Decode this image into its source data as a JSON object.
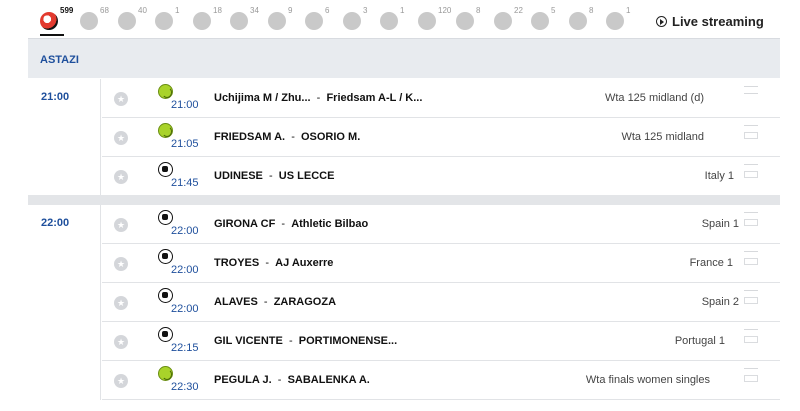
{
  "sportbar": {
    "items": [
      {
        "icon": "soccer-ball-icon",
        "count": "599",
        "active": true
      },
      {
        "icon": "soccer-ball-icon",
        "count": "68"
      },
      {
        "icon": "basketball-icon",
        "count": "40"
      },
      {
        "icon": "baseball-icon",
        "count": "1"
      },
      {
        "icon": "hockey-puck-icon",
        "count": "18"
      },
      {
        "icon": "tennis-ball-icon",
        "count": "34"
      },
      {
        "icon": "volleyball-icon",
        "count": "9"
      },
      {
        "icon": "football-icon",
        "count": "6"
      },
      {
        "icon": "rugby-ball-icon",
        "count": "3"
      },
      {
        "icon": "snooker-triangle-icon",
        "count": "1"
      },
      {
        "icon": "table-tennis-icon",
        "count": "120"
      },
      {
        "icon": "darts-icon",
        "count": "8"
      },
      {
        "icon": "handball-icon",
        "count": "22"
      },
      {
        "icon": "beach-volley-icon",
        "count": "5"
      },
      {
        "icon": "badminton-icon",
        "count": "8"
      },
      {
        "icon": "trophy-icon",
        "count": "1"
      }
    ],
    "live_label": "Live streaming"
  },
  "day": {
    "label": "ASTAZI"
  },
  "groups": [
    {
      "time": "21:00",
      "matches": [
        {
          "sport": "tennis",
          "time": "21:00",
          "home": "Uchijima M / Zhu...",
          "away": "Friedsam A-L / K...",
          "league": "Wta 125 midland (d)"
        },
        {
          "sport": "tennis",
          "time": "21:05",
          "home": "FRIEDSAM A.",
          "away": "OSORIO M.",
          "league": "Wta 125 midland"
        },
        {
          "sport": "soccer",
          "time": "21:45",
          "home": "UDINESE",
          "away": "US LECCE",
          "league": "Italy 1"
        }
      ]
    },
    {
      "time": "22:00",
      "matches": [
        {
          "sport": "soccer",
          "time": "22:00",
          "home": "GIRONA CF",
          "away": "Athletic Bilbao",
          "league": "Spain 1"
        },
        {
          "sport": "soccer",
          "time": "22:00",
          "home": "TROYES",
          "away": "AJ Auxerre",
          "league": "France 1"
        },
        {
          "sport": "soccer",
          "time": "22:00",
          "home": "ALAVES",
          "away": "ZARAGOZA",
          "league": "Spain 2"
        },
        {
          "sport": "soccer",
          "time": "22:15",
          "home": "GIL VICENTE",
          "away": "PORTIMONENSE...",
          "league": "Portugal 1"
        },
        {
          "sport": "tennis",
          "time": "22:30",
          "home": "PEGULA J.",
          "away": "SABALENKA A.",
          "league": "Wta finals women singles"
        }
      ]
    }
  ]
}
